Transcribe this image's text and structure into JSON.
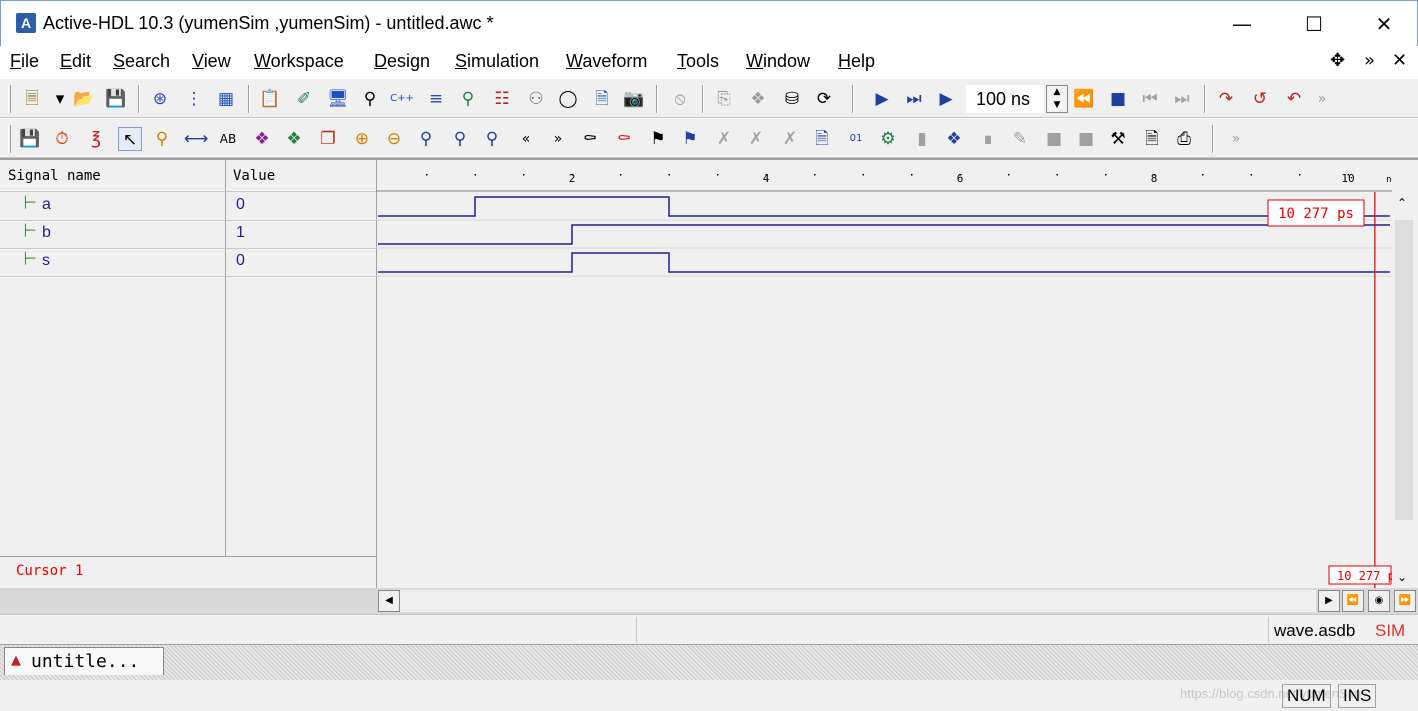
{
  "window": {
    "title": "Active-HDL 10.3 (yumenSim ,yumenSim) - untitled.awc *",
    "app_icon": "A"
  },
  "menu": [
    "File",
    "Edit",
    "Search",
    "View",
    "Workspace",
    "Design",
    "Simulation",
    "Waveform",
    "Tools",
    "Window",
    "Help"
  ],
  "toolbar": {
    "timestep_value": "100 ns"
  },
  "waveform": {
    "header_signal": "Signal name",
    "header_value": "Value",
    "time_unit": "ns",
    "ticks": [
      {
        "label": "2",
        "t": 2
      },
      {
        "label": "4",
        "t": 4
      },
      {
        "label": "6",
        "t": 6
      },
      {
        "label": "8",
        "t": 8
      },
      {
        "label": "10",
        "t": 10
      }
    ],
    "time_range_ns": [
      0,
      10.4
    ],
    "signals": [
      {
        "name": "a",
        "value": "0",
        "transitions": [
          [
            0,
            0
          ],
          [
            1,
            1
          ],
          [
            3,
            0
          ]
        ]
      },
      {
        "name": "b",
        "value": "1",
        "transitions": [
          [
            0,
            0
          ],
          [
            2,
            1
          ]
        ]
      },
      {
        "name": "s",
        "value": "0",
        "transitions": [
          [
            0,
            0
          ],
          [
            2,
            1
          ],
          [
            3,
            0
          ]
        ]
      }
    ],
    "cursor": {
      "label": "Cursor 1",
      "time_text": "10 277 ps",
      "time_ns": 10.277,
      "bottom_text": "10 277 p"
    }
  },
  "status": {
    "document": "wave.asdb",
    "mode": "SIM",
    "doc_tab": "untitle...",
    "num": "NUM",
    "ins": "INS",
    "watermark": "https://blog.csdn.net/yumenSim"
  },
  "colors": {
    "wave": "#1f1f8f",
    "cursor": "#e00000",
    "signal_icon": "#1a7f1a"
  }
}
